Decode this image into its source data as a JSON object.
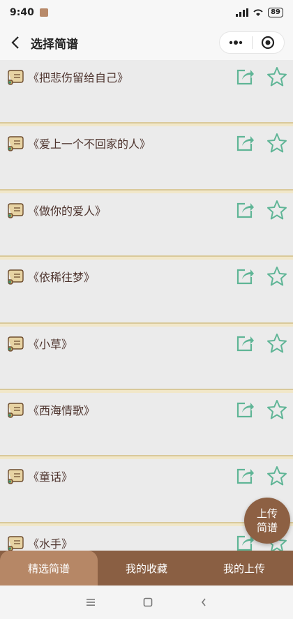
{
  "status_bar": {
    "time": "9:40",
    "battery": "89"
  },
  "nav": {
    "title": "选择简谱"
  },
  "songs": [
    {
      "title": "《把悲伤留给自己》"
    },
    {
      "title": "《爱上一个不回家的人》"
    },
    {
      "title": "《做你的爱人》"
    },
    {
      "title": "《依稀往梦》"
    },
    {
      "title": "《小草》"
    },
    {
      "title": "《西海情歌》"
    },
    {
      "title": "《童话》"
    },
    {
      "title": "《水手》"
    }
  ],
  "fab": {
    "line1": "上传",
    "line2": "简谱"
  },
  "tabs": [
    {
      "label": "精选简谱",
      "active": true
    },
    {
      "label": "我的收藏",
      "active": false
    },
    {
      "label": "我的上传",
      "active": false
    }
  ],
  "colors": {
    "accent_green": "#5fb596",
    "brown": "#8a5f43",
    "tab_active": "#b68766"
  },
  "icons": [
    "scroll-icon",
    "share-icon",
    "star-icon",
    "back-icon",
    "more-icon",
    "close-circle-icon"
  ]
}
